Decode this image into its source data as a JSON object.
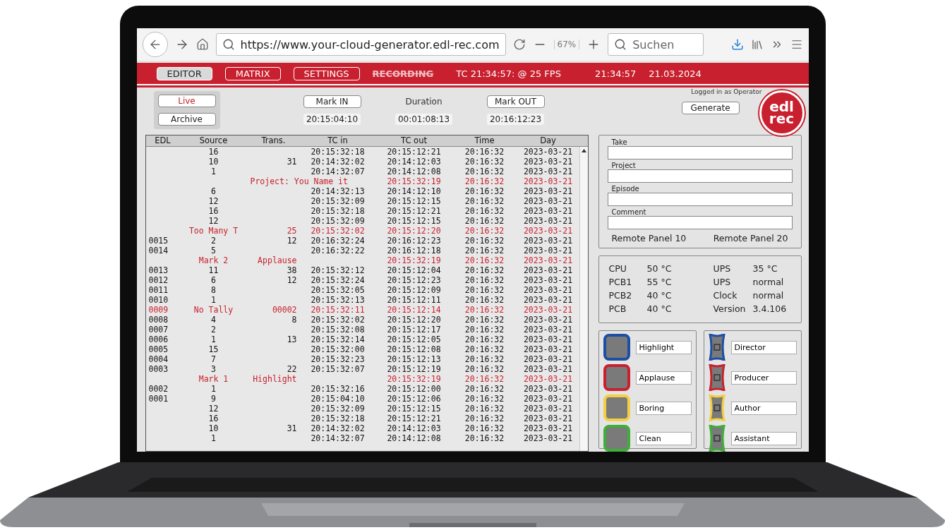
{
  "browser": {
    "url": "https://www.your-cloud-generator.edl-rec.com",
    "zoom": "67%",
    "search": {
      "placeholder": "Suchen"
    }
  },
  "header": {
    "tabs": [
      {
        "label": "EDITOR",
        "selected": true
      },
      {
        "label": "MATRIX",
        "selected": false
      },
      {
        "label": "SETTINGS",
        "selected": false
      }
    ],
    "recording": {
      "label": "RECORDING",
      "active": false
    },
    "timecode": "TC 21:34:57: @ 25 FPS",
    "clock": "21:34:57",
    "date": "21.03.2024",
    "logo": [
      "edl",
      "rec"
    ]
  },
  "controls": {
    "modes": [
      {
        "label": "Live",
        "selected": true
      },
      {
        "label": "Archive",
        "selected": false
      }
    ],
    "marks": [
      {
        "kind": "button",
        "label": "Mark IN",
        "value": "20:15:04:10"
      },
      {
        "kind": "text",
        "label": "Duration",
        "value": "00:01:08:13"
      },
      {
        "kind": "button",
        "label": "Mark OUT",
        "value": "20:16:12:23"
      }
    ],
    "user_note": "Logged in as Operator",
    "generate": "Generate"
  },
  "table": {
    "columns": [
      "EDL",
      "Source",
      "Trans.",
      "TC in",
      "TC out",
      "Time",
      "Day"
    ],
    "rows": [
      {
        "cells": [
          "",
          "16",
          "",
          "20:15:32:18",
          "20:15:12:21",
          "20:16:32",
          "2023-03-21"
        ],
        "alert": false
      },
      {
        "cells": [
          "",
          "10",
          "31",
          "20:14:32:02",
          "20:14:12:03",
          "20:16:32",
          "2023-03-21"
        ],
        "alert": false
      },
      {
        "cells": [
          "",
          "1",
          "",
          "20:14:32:07",
          "20:14:12:08",
          "20:16:32",
          "2023-03-21"
        ],
        "alert": false
      },
      {
        "cells": [
          "",
          "",
          "Project: You Name it",
          "",
          "20:15:32:19",
          "20:16:32",
          "2023-03-21"
        ],
        "alert": true
      },
      {
        "cells": [
          "",
          "6",
          "",
          "20:14:32:13",
          "20:14:12:10",
          "20:16:32",
          "2023-03-21"
        ],
        "alert": false
      },
      {
        "cells": [
          "",
          "12",
          "",
          "20:15:32:09",
          "20:15:12:15",
          "20:16:32",
          "2023-03-21"
        ],
        "alert": false
      },
      {
        "cells": [
          "",
          "16",
          "",
          "20:15:32:18",
          "20:15:12:21",
          "20:16:32",
          "2023-03-21"
        ],
        "alert": false
      },
      {
        "cells": [
          "",
          "12",
          "",
          "20:15:32:09",
          "20:15:12:15",
          "20:16:32",
          "2023-03-21"
        ],
        "alert": false
      },
      {
        "cells": [
          "",
          "Too Many T",
          "25",
          "20:15:32:02",
          "20:15:12:20",
          "20:16:32",
          "2023-03-21"
        ],
        "alert": true
      },
      {
        "cells": [
          "0015",
          "2",
          "12",
          "20:16:32:24",
          "20:16:12:23",
          "20:16:32",
          "2023-03-21"
        ],
        "alert": false
      },
      {
        "cells": [
          "0014",
          "5",
          "",
          "20:16:32:22",
          "20:16:12:18",
          "20:16:32",
          "2023-03-21"
        ],
        "alert": false
      },
      {
        "cells": [
          "",
          "Mark 2",
          "Applause",
          "",
          "20:15:32:19",
          "20:16:32",
          "2023-03-21"
        ],
        "alert": true
      },
      {
        "cells": [
          "0013",
          "11",
          "38",
          "20:15:32:12",
          "20:15:12:04",
          "20:16:32",
          "2023-03-21"
        ],
        "alert": false
      },
      {
        "cells": [
          "0012",
          "6",
          "12",
          "20:15:32:24",
          "20:15:12:23",
          "20:16:32",
          "2023-03-21"
        ],
        "alert": false
      },
      {
        "cells": [
          "0011",
          "8",
          "",
          "20:15:32:05",
          "20:15:12:09",
          "20:16:32",
          "2023-03-21"
        ],
        "alert": false
      },
      {
        "cells": [
          "0010",
          "1",
          "",
          "20:15:32:13",
          "20:15:12:11",
          "20:16:32",
          "2023-03-21"
        ],
        "alert": false
      },
      {
        "cells": [
          "0009",
          "No Tally",
          "00002",
          "20:15:32:11",
          "20:15:12:14",
          "20:16:32",
          "2023-03-21"
        ],
        "alert": true
      },
      {
        "cells": [
          "0008",
          "4",
          "8",
          "20:15:32:02",
          "20:15:12:20",
          "20:16:32",
          "2023-03-21"
        ],
        "alert": false
      },
      {
        "cells": [
          "0007",
          "2",
          "",
          "20:15:32:08",
          "20:15:12:17",
          "20:16:32",
          "2023-03-21"
        ],
        "alert": false
      },
      {
        "cells": [
          "0006",
          "1",
          "13",
          "20:15:32:14",
          "20:15:12:05",
          "20:16:32",
          "2023-03-21"
        ],
        "alert": false
      },
      {
        "cells": [
          "0005",
          "15",
          "",
          "20:15:32:00",
          "20:15:12:08",
          "20:16:32",
          "2023-03-21"
        ],
        "alert": false
      },
      {
        "cells": [
          "0004",
          "7",
          "",
          "20:15:32:23",
          "20:15:12:13",
          "20:16:32",
          "2023-03-21"
        ],
        "alert": false
      },
      {
        "cells": [
          "0003",
          "3",
          "22",
          "20:15:32:07",
          "20:15:12:19",
          "20:16:32",
          "2023-03-21"
        ],
        "alert": false
      },
      {
        "cells": [
          "",
          "Mark 1",
          "Highlight",
          "",
          "20:15:32:19",
          "20:16:32",
          "2023-03-21"
        ],
        "alert": true
      },
      {
        "cells": [
          "0002",
          "1",
          "",
          "20:15:32:16",
          "20:15:12:00",
          "20:16:32",
          "2023-03-21"
        ],
        "alert": false
      },
      {
        "cells": [
          "0001",
          "9",
          "",
          "20:15:04:10",
          "20:15:12:06",
          "20:16:32",
          "2023-03-21"
        ],
        "alert": false
      },
      {
        "cells": [
          "",
          "12",
          "",
          "20:15:32:09",
          "20:15:12:15",
          "20:16:32",
          "2023-03-21"
        ],
        "alert": false
      },
      {
        "cells": [
          "",
          "16",
          "",
          "20:15:32:18",
          "20:15:12:21",
          "20:16:32",
          "2023-03-21"
        ],
        "alert": false
      },
      {
        "cells": [
          "",
          "10",
          "31",
          "20:14:32:02",
          "20:14:12:03",
          "20:16:32",
          "2023-03-21"
        ],
        "alert": false
      },
      {
        "cells": [
          "",
          "1",
          "",
          "20:14:32:07",
          "20:14:12:08",
          "20:16:32",
          "2023-03-21"
        ],
        "alert": false
      }
    ]
  },
  "form": {
    "fields": [
      {
        "label": "Take"
      },
      {
        "label": "Project"
      },
      {
        "label": "Episode"
      },
      {
        "label": "Comment"
      }
    ],
    "remote_panels": [
      "Remote Panel 10",
      "Remote Panel 20"
    ]
  },
  "status": [
    [
      "CPU",
      "50 °C",
      "UPS",
      "35 °C"
    ],
    [
      "PCB1",
      "55 °C",
      "UPS",
      "normal"
    ],
    [
      "PCB2",
      "40 °C",
      "Clock",
      "normal"
    ],
    [
      "PCB",
      "40 °C",
      "Version",
      "3.4.106"
    ]
  ],
  "tallies": {
    "marks": [
      {
        "label": "Highlight",
        "color": "#1c4fa3"
      },
      {
        "label": "Applause",
        "color": "#c8202f"
      },
      {
        "label": "Boring",
        "color": "#f2cf45"
      },
      {
        "label": "Clean",
        "color": "#3fae3a"
      }
    ],
    "roles": [
      {
        "label": "Director",
        "color": "#1c4fa3"
      },
      {
        "label": "Producer",
        "color": "#c8202f"
      },
      {
        "label": "Author",
        "color": "#f2cf45"
      },
      {
        "label": "Assistant",
        "color": "#3fae3a"
      }
    ]
  }
}
